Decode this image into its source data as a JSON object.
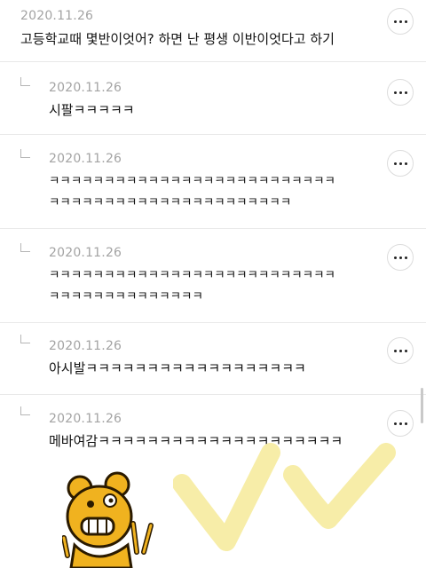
{
  "comments": [
    {
      "date": "2020.11.26",
      "text": "고등학교때 몇반이엇어? 하면 난 평생 이반이엇다고 하기",
      "reply": false
    },
    {
      "date": "2020.11.26",
      "text": "시팔ㅋㅋㅋㅋㅋ",
      "reply": true
    },
    {
      "date": "2020.11.26",
      "text": "ㅋㅋㅋㅋㅋㅋㅋㅋㅋㅋㅋㅋㅋㅋㅋㅋㅋㅋㅋㅋㅋㅋㅋㅋㅋㅋ\nㅋㅋㅋㅋㅋㅋㅋㅋㅋㅋㅋㅋㅋㅋㅋㅋㅋㅋㅋㅋㅋㅋ",
      "reply": true
    },
    {
      "date": "2020.11.26",
      "text": "ㅋㅋㅋㅋㅋㅋㅋㅋㅋㅋㅋㅋㅋㅋㅋㅋㅋㅋㅋㅋㅋㅋㅋㅋㅋㅋ\nㅋㅋㅋㅋㅋㅋㅋㅋㅋㅋㅋㅋㅋㅋ",
      "reply": true
    },
    {
      "date": "2020.11.26",
      "text": "아시발ㅋㅋㅋㅋㅋㅋㅋㅋㅋㅋㅋㅋㅋㅋㅋㅋㅋㅋ",
      "reply": true
    },
    {
      "date": "2020.11.26",
      "text": "메바여감ㅋㅋㅋㅋㅋㅋㅋㅋㅋㅋㅋㅋㅋㅋㅋㅋㅋㅋㅋㅋ",
      "reply": true
    }
  ],
  "icons": {
    "more": "more-options-icon",
    "reply": "reply-arrow-icon",
    "sticker": "bear-sticker-icon",
    "doodle": "v-scribble-icon"
  },
  "colors": {
    "date": "#a3a3a3",
    "divider": "#e9e9e9",
    "sticker_yellow": "#f0b21f",
    "doodle_yellow": "#f7eda8"
  }
}
